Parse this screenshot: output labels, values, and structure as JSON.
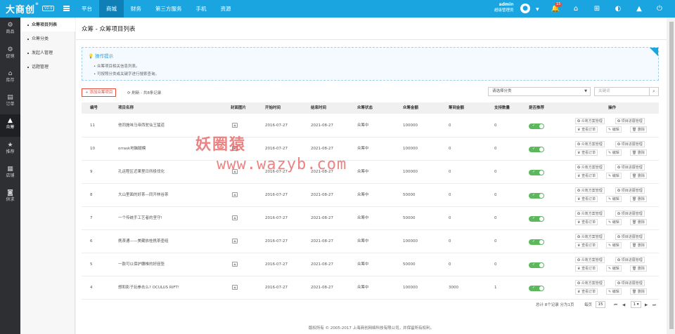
{
  "topbar": {
    "logo": "大商创",
    "logo_mark": "®",
    "version": "V2.0",
    "nav": [
      "平台",
      "商城",
      "财务",
      "第三方服务",
      "手机",
      "资源"
    ],
    "user_name": "admin",
    "user_role": "超级管理员",
    "notification_count": "15",
    "colors": {
      "bar": "#1ba5e0",
      "active": "#0f7fb5"
    }
  },
  "sidebar": [
    {
      "icon": "gear-icon",
      "label": "商品"
    },
    {
      "icon": "gear-icon",
      "label": "促销"
    },
    {
      "icon": "house-icon",
      "label": "库存"
    },
    {
      "icon": "doc-icon",
      "label": "订单"
    },
    {
      "icon": "chart-icon",
      "label": "众筹"
    },
    {
      "icon": "star-icon",
      "label": "推荐"
    },
    {
      "icon": "store-icon",
      "label": "店铺"
    },
    {
      "icon": "box-icon",
      "label": "供求"
    }
  ],
  "subnav": [
    "众筹项目列表",
    "众筹分类",
    "发起人管理",
    "话题管理"
  ],
  "page": {
    "title": "众筹 - 众筹项目列表",
    "tips_title": "操作提示",
    "tips": [
      "众筹项目相关信息列表。",
      "可按照分类或关键字进行搜索查询。"
    ],
    "add_button": "添加众筹项目",
    "refresh": "刷新 - 共8条记录",
    "category_select": "请选择分类",
    "keyword_placeholder": "关键词"
  },
  "table": {
    "headers": [
      "编号",
      "项目名称",
      "封面图片",
      "开始时间",
      "结束时间",
      "众筹状态",
      "众筹金额",
      "筹到金额",
      "支持数量",
      "是否推荐",
      "操作"
    ],
    "ops": {
      "plan": "众筹方案管理",
      "progress": "项目进展管理",
      "orders": "查看订单",
      "edit": "编辑",
      "delete": "删除"
    },
    "rows": [
      {
        "id": "11",
        "name": "他同施味马帝西驼仙王猛道",
        "start": "2016-07-27",
        "end": "2021-08-27",
        "status": "众筹中",
        "goal": "100000",
        "raised": "0",
        "supporters": "0"
      },
      {
        "id": "10",
        "name": "orrask地脑腿模",
        "start": "2016-07-27",
        "end": "2021-08-27",
        "status": "众筹中",
        "goal": "100000",
        "raised": "0",
        "supporters": "0"
      },
      {
        "id": "9",
        "name": "孔运程区近果里日所极伐化",
        "start": "2016-07-27",
        "end": "2021-08-27",
        "status": "众筹中",
        "goal": "100000",
        "raised": "0",
        "supporters": "0"
      },
      {
        "id": "8",
        "name": "大山里面的好茶—同开林谷茶",
        "start": "2016-07-27",
        "end": "2021-08-27",
        "status": "众筹中",
        "goal": "50000",
        "raised": "0",
        "supporters": "0"
      },
      {
        "id": "7",
        "name": "一个传统手工艺者的坚守!",
        "start": "2016-07-27",
        "end": "2021-08-27",
        "status": "众筹中",
        "goal": "50000",
        "raised": "0",
        "supporters": "0"
      },
      {
        "id": "6",
        "name": "携茶通——美藏依桂携茶壶组",
        "start": "2016-07-27",
        "end": "2021-08-27",
        "status": "众筹中",
        "goal": "100000",
        "raised": "0",
        "supporters": "0"
      },
      {
        "id": "5",
        "name": "一款可以保护腰椎的好座垫",
        "start": "2016-07-27",
        "end": "2021-08-27",
        "status": "众筹中",
        "goal": "50000",
        "raised": "0",
        "supporters": "0"
      },
      {
        "id": "4",
        "name": "想和影子玩拳击么? OCULUS RIFT!",
        "start": "2016-07-27",
        "end": "2021-08-27",
        "status": "众筹中",
        "goal": "100000",
        "raised": "3000",
        "supporters": "1"
      }
    ]
  },
  "pagination": {
    "summary": "总计 8个记录 分为1页",
    "per_page_label": "每页",
    "per_page": "15",
    "page": "1",
    "first": "⏮",
    "prev": "◀",
    "next": "▶",
    "last": "⏭"
  },
  "footer": "版权所有 © 2005-2017 上海商创网络科技有限公司，并保留所有权利。",
  "watermark": {
    "line1": "妖圈猿",
    "line2": "www.wazyb.com"
  }
}
